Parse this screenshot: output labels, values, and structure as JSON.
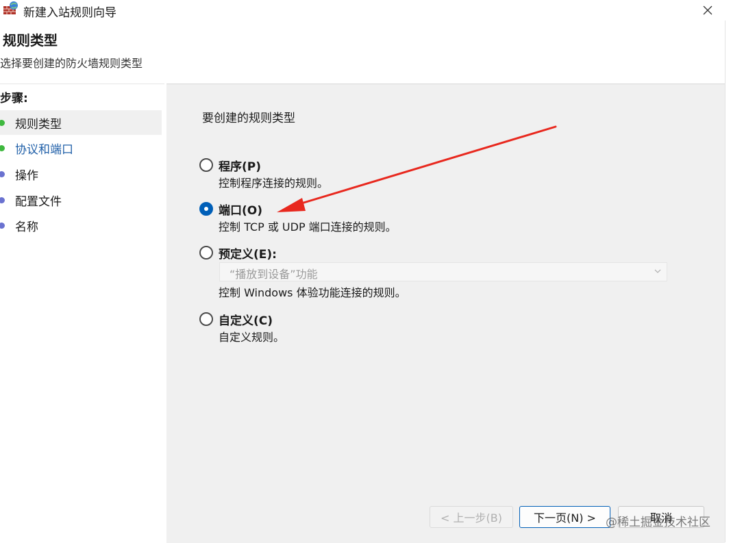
{
  "window": {
    "title": "新建入站规则向导",
    "close_icon": "close-icon"
  },
  "header": {
    "title": "规则类型",
    "subtitle": "选择要创建的防火墙规则类型"
  },
  "steps": {
    "title": "步骤:",
    "items": [
      {
        "label": "规则类型",
        "state": "done"
      },
      {
        "label": "协议和端口",
        "state": "current"
      },
      {
        "label": "操作",
        "state": "pending"
      },
      {
        "label": "配置文件",
        "state": "pending"
      },
      {
        "label": "名称",
        "state": "pending"
      }
    ]
  },
  "main": {
    "question": "要创建的规则类型",
    "options": [
      {
        "label": "程序(P)",
        "desc": "控制程序连接的规则。",
        "selected": false
      },
      {
        "label": "端口(O)",
        "desc": "控制 TCP 或 UDP 端口连接的规则。",
        "selected": true
      },
      {
        "label": "预定义(E):",
        "desc": "控制 Windows 体验功能连接的规则。",
        "selected": false
      },
      {
        "label": "自定义(C)",
        "desc": "自定义规则。",
        "selected": false
      }
    ],
    "predefined_select": {
      "value": "“播放到设备”功能"
    }
  },
  "buttons": {
    "back": "< 上一步(B)",
    "next": "下一页(N) >",
    "cancel": "取消"
  },
  "watermark": "@稀土掘金技术社区",
  "colors": {
    "accent": "#005fb8",
    "annotation_arrow": "#e8281e",
    "step_done": "#3fb83f",
    "step_pending": "#6a72d0"
  }
}
